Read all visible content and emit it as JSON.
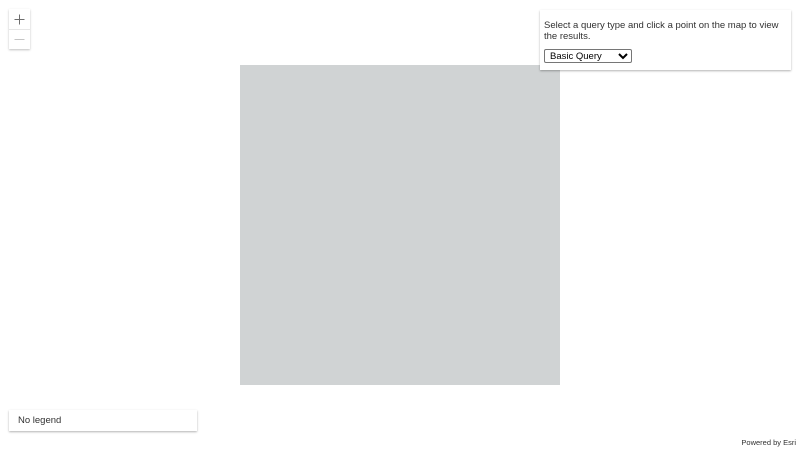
{
  "zoom": {
    "in_icon": "plus-icon",
    "out_icon": "minus-icon"
  },
  "query_panel": {
    "instructions": "Select a query type and click a point on the map to view the results.",
    "select": {
      "selected": "Basic Query",
      "options": [
        "Basic Query"
      ]
    }
  },
  "legend": {
    "text": "No legend"
  },
  "attribution": {
    "text": "Powered by Esri"
  },
  "colors": {
    "map_layer": "#d0d3d4",
    "background": "#ffffff"
  }
}
